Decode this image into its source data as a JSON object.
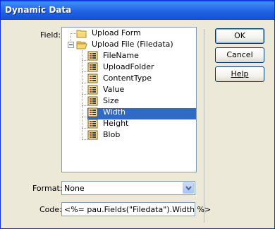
{
  "window": {
    "title": "Dynamic Data"
  },
  "field_label": "Field:",
  "tree": {
    "nodes": [
      {
        "label": "Upload Form",
        "icon": "folder-icon"
      },
      {
        "label": "Upload File (Filedata)",
        "icon": "folder-open-icon",
        "expanded": true
      },
      {
        "label": "FileName",
        "icon": "field-icon"
      },
      {
        "label": "UploadFolder",
        "icon": "field-icon"
      },
      {
        "label": "ContentType",
        "icon": "field-icon"
      },
      {
        "label": "Value",
        "icon": "field-icon"
      },
      {
        "label": "Size",
        "icon": "field-icon"
      },
      {
        "label": "Width",
        "icon": "field-icon",
        "selected": true
      },
      {
        "label": "Height",
        "icon": "field-icon"
      },
      {
        "label": "Blob",
        "icon": "field-icon"
      }
    ]
  },
  "buttons": {
    "ok": "OK",
    "cancel": "Cancel",
    "help": "Help"
  },
  "format": {
    "label": "Format:",
    "value": "None"
  },
  "code": {
    "label": "Code:",
    "value": "<%= pau.Fields(\"Filedata\").Width %>"
  },
  "colors": {
    "titlebar": "#1E5FE0",
    "selection": "#316AC5",
    "dialog_bg": "#ECE9D8"
  }
}
